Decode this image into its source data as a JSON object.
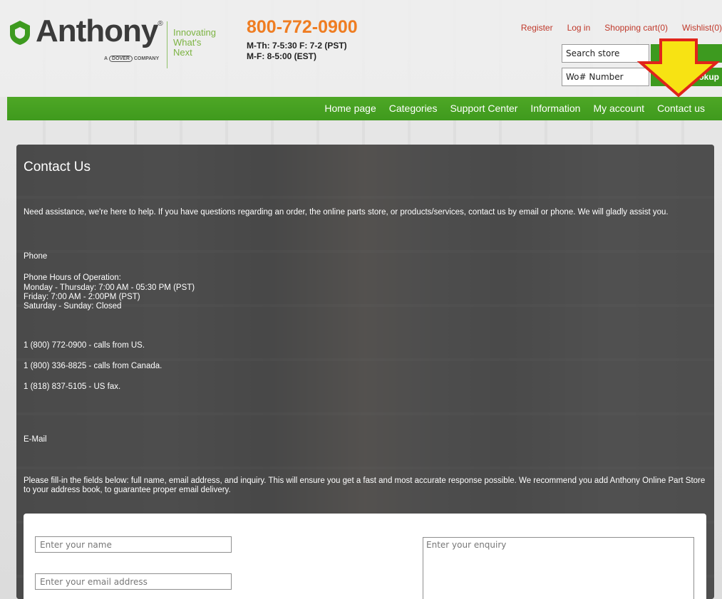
{
  "brand": {
    "name": "Anthony",
    "reg": "®",
    "sub_prefix": "A",
    "sub_box": "DOVER",
    "sub_suffix": "COMPANY",
    "tagline": [
      "Innovating",
      "What's",
      "Next"
    ],
    "green": "#7cb342"
  },
  "contact_header": {
    "phone": "800-772-0900",
    "hours_line1": "M-Th: 7-5:30 F: 7-2 (PST)",
    "hours_line2": "M-F: 8-5:00 (EST)",
    "phone_color": "#ef7d22"
  },
  "toplinks": {
    "register": "Register",
    "login": "Log in",
    "cart": "Shopping cart(0)",
    "wishlist": "Wishlist(0)"
  },
  "search": {
    "value": "Search store",
    "wo_value": "Wo# Number",
    "wo_button": "Lookup"
  },
  "nav": {
    "items": [
      "Home page",
      "Categories",
      "Support Center",
      "Information",
      "My account",
      "Contact us"
    ],
    "color": "#3f9a1d"
  },
  "annotation": {
    "arrow_icon": "down-arrow-icon",
    "arrow_fill": "#f7e313",
    "arrow_stroke": "#e0241b"
  },
  "page": {
    "title": "Contact Us",
    "intro": "Need assistance, we're here to help. If you have questions regarding an order, the online parts store, or products/services, contact us by email or phone. We will gladly assist you.",
    "phone_heading": "Phone",
    "hours_heading": "Phone Hours of Operation:",
    "hours": [
      "Monday - Thursday: 7:00 AM - 05:30 PM (PST)",
      "Friday: 7:00 AM - 2:00PM (PST)",
      "Saturday - Sunday: Closed"
    ],
    "numbers": [
      "1 (800) 772-0900  - calls from US.",
      "1 (800) 336-8825  - calls from Canada.",
      "1 (818) 837-5105  - US fax."
    ],
    "email_heading": "E-Mail",
    "email_text": "Please fill-in the fields below: full name, email address, and inquiry. This will ensure you get a fast and most accurate response possible. We recommend you add Anthony Online Part Store to your address book, to guarantee proper email delivery."
  },
  "form": {
    "name_placeholder": "Enter your name",
    "email_placeholder": "Enter your email address",
    "enquiry_placeholder": "Enter your enquiry"
  }
}
